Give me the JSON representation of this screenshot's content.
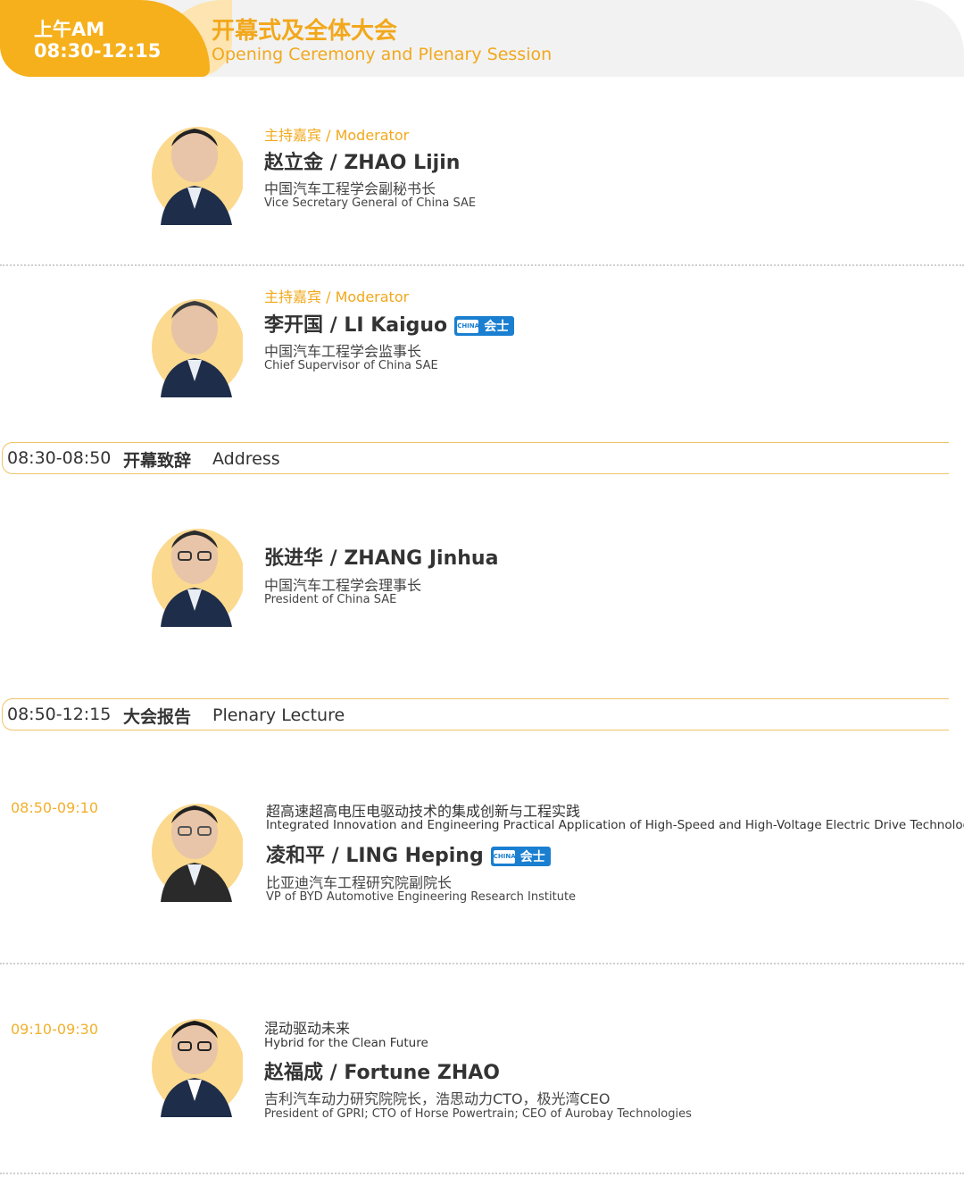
{
  "header": {
    "ampm": "上午AM",
    "time_range": "08:30-12:15",
    "title_cn": "开幕式及全体大会",
    "title_en": "Opening Ceremony and Plenary Session"
  },
  "moderators": [
    {
      "role": "主持嘉宾 / Moderator",
      "name": "赵立金 / ZHAO Lijin",
      "title_cn": "中国汽车工程学会副秘书长",
      "title_en": "Vice Secretary General of China SAE"
    },
    {
      "role": "主持嘉宾 / Moderator",
      "name": "李开国 / LI Kaiguo",
      "badge": "会士",
      "title_cn": "中国汽车工程学会监事长",
      "title_en": "Chief Supervisor of China SAE"
    }
  ],
  "address": {
    "time": "08:30-08:50",
    "label_cn": "开幕致辞",
    "label_en": "Address",
    "speaker": {
      "name": "张进华 / ZHANG Jinhua",
      "title_cn": "中国汽车工程学会理事长",
      "title_en": "President of China SAE"
    }
  },
  "plenary": {
    "time": "08:50-12:15",
    "label_cn": "大会报告",
    "label_en": "Plenary Lecture",
    "talks": [
      {
        "time": "08:50-09:10",
        "topic_cn": "超高速超高电压电驱动技术的集成创新与工程实践",
        "topic_en": "Integrated Innovation and Engineering Practical Application of High-Speed and High-Voltage Electric Drive Technology",
        "name": "凌和平 / LING Heping",
        "badge": "会士",
        "title_cn": "比亚迪汽车工程研究院副院长",
        "title_en": "VP of BYD Automotive Engineering Research Institute"
      },
      {
        "time": "09:10-09:30",
        "topic_cn": "混动驱动未来",
        "topic_en": "Hybrid for the Clean Future",
        "name": "赵福成 / Fortune ZHAO",
        "title_cn": "吉利汽车动力研究院院长，浩思动力CTO，极光湾CEO",
        "title_en": "President of GPRI; CTO of Horse Powertrain; CEO of Aurobay Technologies"
      }
    ]
  },
  "badge_logo_text": "CHINA SAE",
  "colors": {
    "accent": "#f6b01c",
    "badge": "#1a7fd0"
  }
}
